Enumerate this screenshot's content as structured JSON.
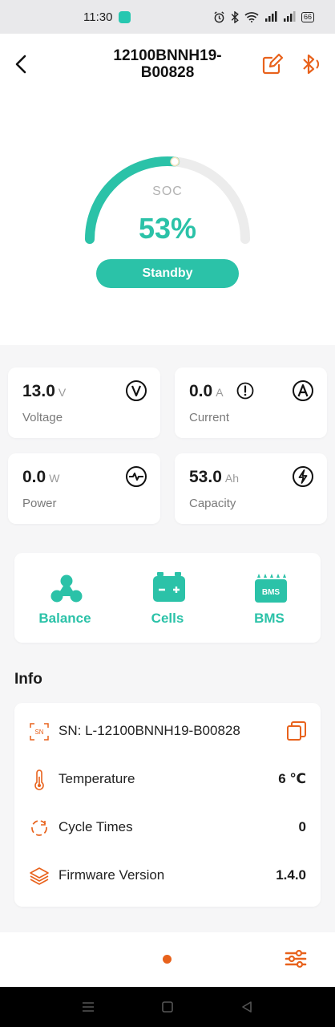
{
  "status_bar": {
    "time": "11:30",
    "battery": "66"
  },
  "header": {
    "title": "12100BNNH19-B00828"
  },
  "gauge": {
    "label": "SOC",
    "value_text": "53%",
    "fraction": 0.53,
    "state": "Standby",
    "accent_color": "#2bc2a8",
    "track_color": "#ececec"
  },
  "metrics": [
    {
      "value": "13.0",
      "unit": "V",
      "label": "Voltage",
      "icon": "voltage-icon"
    },
    {
      "value": "0.0",
      "unit": "A",
      "label": "Current",
      "icon": "current-icon"
    },
    {
      "value": "0.0",
      "unit": "W",
      "label": "Power",
      "icon": "power-icon"
    },
    {
      "value": "53.0",
      "unit": "Ah",
      "label": "Capacity",
      "icon": "capacity-icon"
    }
  ],
  "shortcuts": [
    {
      "label": "Balance",
      "icon": "balance-icon"
    },
    {
      "label": "Cells",
      "icon": "battery-cells-icon"
    },
    {
      "label": "BMS",
      "icon": "bms-icon",
      "icon_text": "BMS"
    }
  ],
  "info": {
    "title": "Info",
    "sn_badge": "SN",
    "sn_label": "SN:",
    "sn_value": "L-12100BNNH19-B00828",
    "rows": [
      {
        "label": "Temperature",
        "value": "6 ℃",
        "icon": "thermometer-icon"
      },
      {
        "label": "Cycle Times",
        "value": "0",
        "icon": "cycle-icon"
      },
      {
        "label": "Firmware Version",
        "value": "1.4.0",
        "icon": "layers-icon"
      }
    ]
  },
  "colors": {
    "accent": "#2bc2a8",
    "orange": "#e8621c"
  }
}
